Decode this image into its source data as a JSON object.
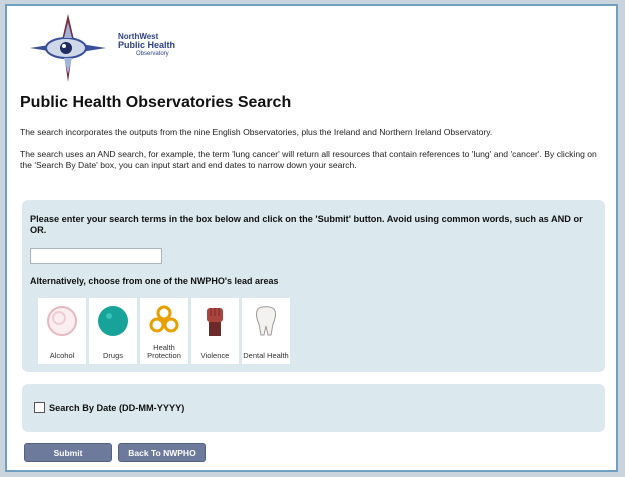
{
  "logo": {
    "line1": "NorthWest",
    "line2": "Public Health",
    "line3": "Observatory"
  },
  "page_title": "Public Health Observatories Search",
  "intro": "The search incorporates the outputs from the nine English Observatories, plus the Ireland and Northern Ireland Observatory.",
  "search_help": "The search uses an AND search, for example, the term 'lung cancer' will return all resources that contain references to 'lung' and 'cancer'. By clicking on the 'Search By Date' box, you can input start and end dates to narrow down your search.",
  "form": {
    "instructions": "Please enter your search terms in the box below and click on the 'Submit' button. Avoid using common words, such as AND or OR.",
    "search_value": "",
    "alt_label": "Alternatively, choose from one of the NWPHO's lead areas",
    "areas": [
      {
        "label": "Alcohol",
        "icon": "alcohol-icon"
      },
      {
        "label": "Drugs",
        "icon": "drugs-icon"
      },
      {
        "label": "Health Protection",
        "icon": "biohazard-icon"
      },
      {
        "label": "Violence",
        "icon": "fist-icon"
      },
      {
        "label": "Dental Health",
        "icon": "tooth-icon"
      }
    ],
    "date_label": "Search By Date (DD-MM-YYYY)"
  },
  "buttons": {
    "submit": "Submit",
    "back": "Back To NWPHO"
  },
  "colors": {
    "panel": "#dbe9ef",
    "button": "#6d7a9c",
    "border": "#6f9fc3"
  }
}
